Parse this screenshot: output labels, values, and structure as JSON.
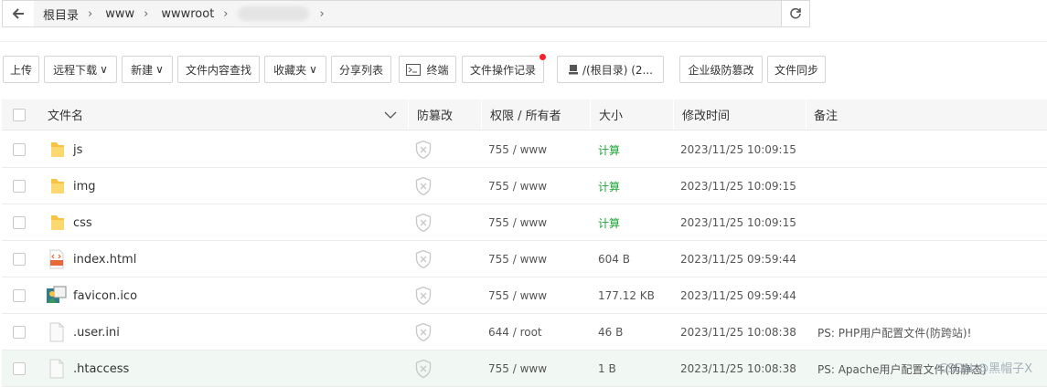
{
  "address_bar": {
    "crumbs": [
      "根目录",
      "www",
      "wwwroot"
    ]
  },
  "toolbar": {
    "upload": "上传",
    "remote_download": "远程下载",
    "new": "新建",
    "search_content": "文件内容查找",
    "favorites": "收藏夹",
    "share_list": "分享列表",
    "terminal": "终端",
    "file_log": "文件操作记录",
    "disk": "/(根目录) (2...",
    "tamper": "企业级防篡改",
    "sync": "文件同步"
  },
  "table": {
    "headers": {
      "name": "文件名",
      "tamper": "防篡改",
      "perm": "权限 / 所有者",
      "size": "大小",
      "mtime": "修改时间",
      "remark": "备注"
    },
    "rows": [
      {
        "name": "js",
        "icon": "folder-icon",
        "perm": "755 / www",
        "size": "计算",
        "mtime": "2023/11/25 10:09:15",
        "remark": ""
      },
      {
        "name": "img",
        "icon": "folder-icon",
        "perm": "755 / www",
        "size": "计算",
        "mtime": "2023/11/25 10:09:15",
        "remark": ""
      },
      {
        "name": "css",
        "icon": "folder-icon",
        "perm": "755 / www",
        "size": "计算",
        "mtime": "2023/11/25 10:09:15",
        "remark": ""
      },
      {
        "name": "index.html",
        "icon": "html-file-icon",
        "perm": "755 / www",
        "size": "604 B",
        "mtime": "2023/11/25 09:59:44",
        "remark": ""
      },
      {
        "name": "favicon.ico",
        "icon": "image-file-icon",
        "perm": "755 / www",
        "size": "177.12 KB",
        "mtime": "2023/11/25 09:59:44",
        "remark": ""
      },
      {
        "name": ".user.ini",
        "icon": "text-file-icon",
        "perm": "644 / root",
        "size": "46 B",
        "mtime": "2023/11/25 10:08:38",
        "remark": "PS: PHP用户配置文件(防跨站)!"
      },
      {
        "name": ".htaccess",
        "icon": "text-file-icon",
        "perm": "755 / www",
        "size": "1 B",
        "mtime": "2023/11/25 10:08:38",
        "remark": "PS: Apache用户配置文件(伪静态)"
      }
    ]
  },
  "watermark": "CSDN @黑帽子X",
  "colors": {
    "calc": "#20a53a",
    "folder": "#f6c342",
    "badge": "#f5222d"
  }
}
